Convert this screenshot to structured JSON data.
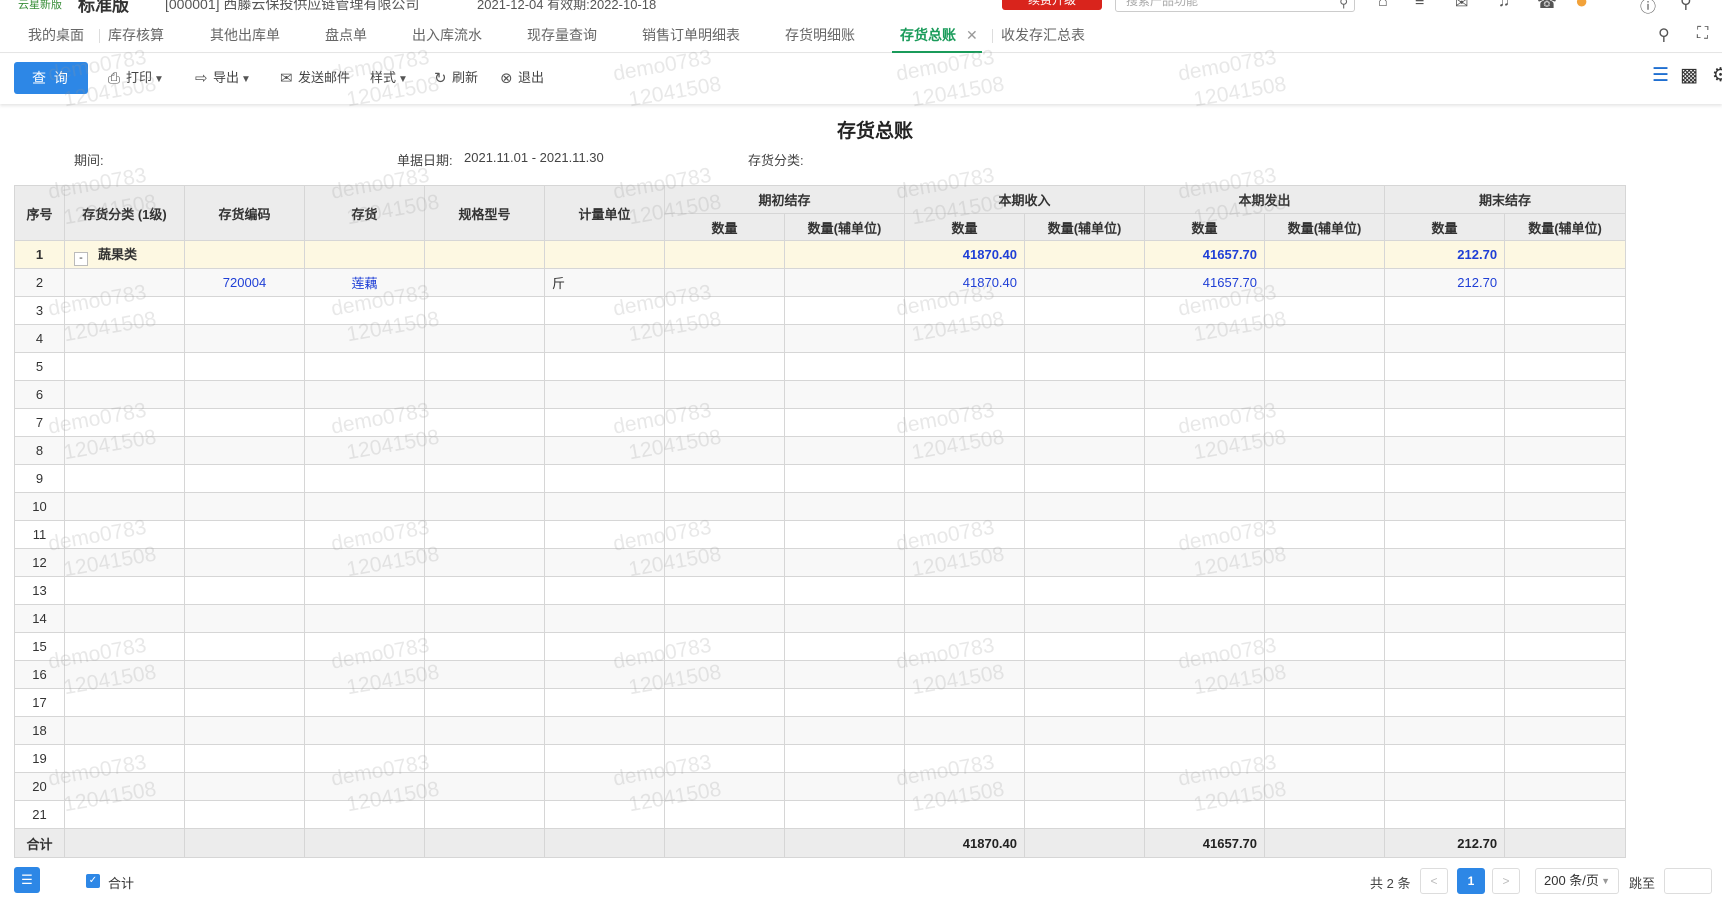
{
  "header": {
    "logo_text": "云星新版",
    "edition": "标准版",
    "company": "[000001] 西藤云保投供应链管理有限公司",
    "date": "2021-12-04 有效期:2022-10-18",
    "renew_label": "续费升级",
    "search_placeholder": "搜索产品功能"
  },
  "tabs": [
    {
      "label": "我的桌面"
    },
    {
      "label": "库存核算"
    },
    {
      "label": "其他出库单"
    },
    {
      "label": "盘点单"
    },
    {
      "label": "出入库流水"
    },
    {
      "label": "现存量查询"
    },
    {
      "label": "销售订单明细表"
    },
    {
      "label": "存货明细账"
    },
    {
      "label": "存货总账",
      "active": true
    },
    {
      "label": "收发存汇总表"
    }
  ],
  "toolbar": {
    "query": "查 询",
    "print": "打印",
    "export": "导出",
    "email": "发送邮件",
    "style": "样式",
    "refresh": "刷新",
    "exit": "退出"
  },
  "report": {
    "title": "存货总账",
    "period_label": "期间:",
    "date_label": "单据日期:",
    "date_value": "2021.11.01 - 2021.11.30",
    "category_label": "存货分类:"
  },
  "table": {
    "headers": {
      "seq": "序号",
      "category": "存货分类 (1级)",
      "code": "存货编码",
      "item": "存货",
      "spec": "规格型号",
      "unit": "计量单位",
      "opening": "期初结存",
      "receipt": "本期收入",
      "issue": "本期发出",
      "closing": "期末结存",
      "qty": "数量",
      "qty_aux": "数量(辅单位)"
    },
    "rows": [
      {
        "seq": "1",
        "category": "蔬果类",
        "code": "",
        "item": "",
        "spec": "",
        "unit": "",
        "open_qty": "",
        "open_aux": "",
        "in_qty": "41870.40",
        "in_aux": "",
        "out_qty": "41657.70",
        "out_aux": "",
        "end_qty": "212.70",
        "end_aux": ""
      },
      {
        "seq": "2",
        "category": "",
        "code": "720004",
        "item": "莲藕",
        "spec": "",
        "unit": "斤",
        "open_qty": "",
        "open_aux": "",
        "in_qty": "41870.40",
        "in_aux": "",
        "out_qty": "41657.70",
        "out_aux": "",
        "end_qty": "212.70",
        "end_aux": ""
      },
      {
        "seq": "3"
      },
      {
        "seq": "4"
      },
      {
        "seq": "5"
      },
      {
        "seq": "6"
      },
      {
        "seq": "7"
      },
      {
        "seq": "8"
      },
      {
        "seq": "9"
      },
      {
        "seq": "10"
      },
      {
        "seq": "11"
      },
      {
        "seq": "12"
      },
      {
        "seq": "13"
      },
      {
        "seq": "14"
      },
      {
        "seq": "15"
      },
      {
        "seq": "16"
      },
      {
        "seq": "17"
      },
      {
        "seq": "18"
      },
      {
        "seq": "19"
      },
      {
        "seq": "20"
      },
      {
        "seq": "21"
      }
    ],
    "total": {
      "label": "合计",
      "in_qty": "41870.40",
      "out_qty": "41657.70",
      "end_qty": "212.70"
    }
  },
  "footer": {
    "menu_icon": "☰",
    "total_checkbox_label": "合计",
    "total_records": "共 2 条",
    "current_page": "1",
    "page_size": "200 条/页",
    "jump_label": "跳至"
  },
  "watermark": {
    "line1": "demo0783",
    "line2": "12041508"
  },
  "colors": {
    "accent_green": "#1a9b5a",
    "primary_blue": "#2d87e6",
    "link_blue": "#1f3fd6",
    "group_row": "#fdf8e2"
  }
}
